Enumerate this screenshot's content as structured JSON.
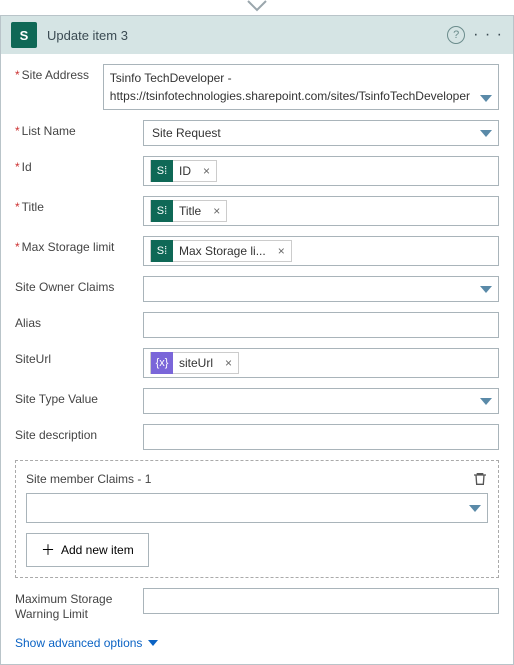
{
  "header": {
    "icon_letter": "S",
    "title": "Update item 3"
  },
  "fields": {
    "site_address": {
      "label": "Site Address",
      "line1": "Tsinfo TechDeveloper -",
      "line2": "https://tsinfotechnologies.sharepoint.com/sites/TsinfoTechDeveloper"
    },
    "list_name": {
      "label": "List Name",
      "value": "Site Request"
    },
    "id": {
      "label": "Id",
      "token": "ID"
    },
    "title": {
      "label": "Title",
      "token": "Title"
    },
    "max_storage": {
      "label": "Max Storage limit",
      "token": "Max Storage li..."
    },
    "site_owner": {
      "label": "Site Owner Claims"
    },
    "alias": {
      "label": "Alias"
    },
    "site_url": {
      "label": "SiteUrl",
      "token": "siteUrl"
    },
    "site_type": {
      "label": "Site Type Value"
    },
    "site_desc": {
      "label": "Site description"
    },
    "group_title": "Site member Claims - 1",
    "add_item": "Add new item",
    "max_warn": {
      "label": "Maximum Storage Warning Limit"
    }
  },
  "advanced": "Show advanced options"
}
